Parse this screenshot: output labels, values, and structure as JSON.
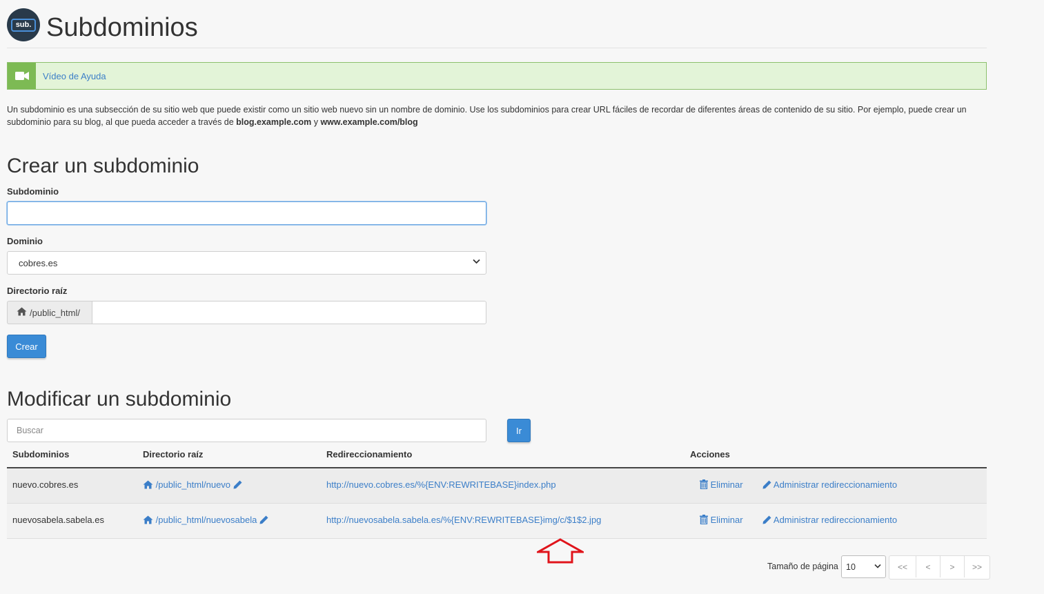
{
  "header": {
    "logo_text": "sub.",
    "title": "Subdominios"
  },
  "help": {
    "label": "Vídeo de Ayuda"
  },
  "intro": {
    "text": "Un subdominio es una subsección de su sitio web que puede existir como un sitio web nuevo sin un nombre de dominio. Use los subdominios para crear URL fáciles de recordar de diferentes áreas de contenido de su sitio. Por ejemplo, puede crear un subdominio para su blog, al que pueda acceder a través de ",
    "example1": "blog.example.com",
    "conj": " y ",
    "example2": "www.example.com/blog"
  },
  "create": {
    "heading": "Crear un subdominio",
    "subdomain_label": "Subdominio",
    "subdomain_value": "",
    "domain_label": "Dominio",
    "domain_value": "cobres.es",
    "docroot_label": "Directorio raíz",
    "docroot_prefix": "/public_html/",
    "docroot_value": "",
    "submit_label": "Crear"
  },
  "modify": {
    "heading": "Modificar un subdominio",
    "search_placeholder": "Buscar",
    "go_label": "Ir",
    "columns": [
      "Subdominios",
      "Directorio raíz",
      "Redireccionamiento",
      "Acciones"
    ],
    "rows": [
      {
        "subdomain": "nuevo.cobres.es",
        "docroot": "/public_html/nuevo",
        "redirect": "http://nuevo.cobres.es/%{ENV:REWRITEBASE}index.php",
        "delete_label": "Eliminar",
        "manage_label": "Administrar redireccionamiento"
      },
      {
        "subdomain": "nuevosabela.sabela.es",
        "docroot": "/public_html/nuevosabela",
        "redirect": "http://nuevosabela.sabela.es/%{ENV:REWRITEBASE}img/c/$1$2.jpg",
        "delete_label": "Eliminar",
        "manage_label": "Administrar redireccionamiento"
      }
    ]
  },
  "pagination": {
    "page_size_label": "Tamaño de página",
    "page_size_value": "10",
    "buttons": [
      "<<",
      "<",
      ">",
      ">>"
    ]
  },
  "colors": {
    "accent": "#3a8bd6",
    "link": "#3b7ec8",
    "help_bg": "#e3f4d8",
    "help_icon_bg": "#7dba54",
    "arrow": "#e0141b"
  },
  "icons": {
    "help": "video-camera-icon",
    "home": "home-icon",
    "edit": "pencil-icon",
    "delete": "trash-icon",
    "pointer": "up-arrow-icon"
  }
}
